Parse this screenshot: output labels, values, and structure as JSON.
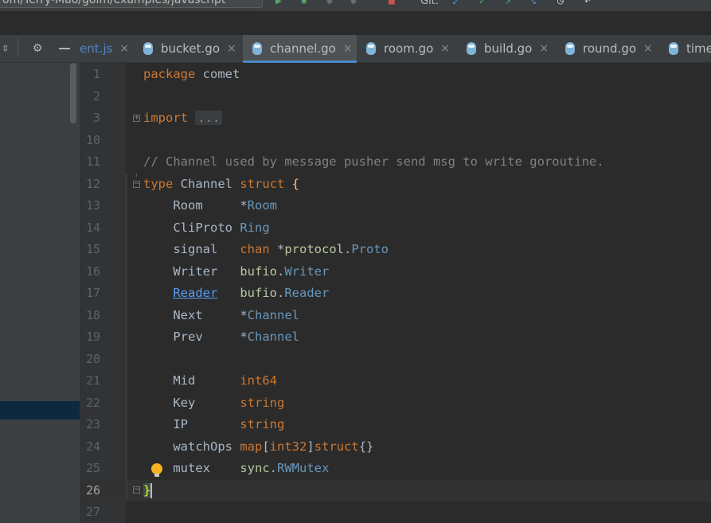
{
  "toolbar": {
    "path_text": "om/Terry-Mao/goim/examples/javascript",
    "git_label": "Git:"
  },
  "tabs": [
    {
      "label": "ent.js",
      "active": false
    },
    {
      "label": "bucket.go",
      "active": false
    },
    {
      "label": "channel.go",
      "active": true
    },
    {
      "label": "room.go",
      "active": false
    },
    {
      "label": "build.go",
      "active": false
    },
    {
      "label": "round.go",
      "active": false
    },
    {
      "label": "time",
      "active": false
    }
  ],
  "tab_close_glyph": "×",
  "editor": {
    "current_line": "26",
    "line_numbers": [
      "1",
      "2",
      "3",
      "10",
      "11",
      "12",
      "13",
      "14",
      "15",
      "16",
      "17",
      "18",
      "19",
      "20",
      "21",
      "22",
      "23",
      "24",
      "25",
      "26",
      "27"
    ],
    "code": {
      "l1_kw": "package",
      "l1_name": " comet",
      "l3_kw": "import",
      "l3_collapsed": "...",
      "l11_comment": "// Channel used by message pusher send msg to write goroutine.",
      "l12_kw": "type",
      "l12_name": " Channel ",
      "l12_kw2": "struct",
      "l12_brace": "{",
      "l13_field": "    Room     ",
      "l13_ptr": "*",
      "l13_type": "Room",
      "l14_field": "    CliProto ",
      "l14_type": "Ring",
      "l15_field": "    signal   ",
      "l15_kw": "chan",
      "l15_ptr": " *",
      "l15_pkg": "protocol",
      "l15_dot": ".",
      "l15_type": "Proto",
      "l16_field": "    Writer   ",
      "l16_pkg": "bufio",
      "l16_dot": ".",
      "l16_type": "Writer",
      "l17_indent": "    ",
      "l17_field": "Reader",
      "l17_pad": "   ",
      "l17_pkg": "bufio",
      "l17_dot": ".",
      "l17_type": "Reader",
      "l18_field": "    Next     ",
      "l18_ptr": "*",
      "l18_type": "Channel",
      "l19_field": "    Prev     ",
      "l19_ptr": "*",
      "l19_type": "Channel",
      "l21_field": "    Mid      ",
      "l21_type": "int64",
      "l22_field": "    Key      ",
      "l22_type": "string",
      "l23_field": "    IP       ",
      "l23_type": "string",
      "l24_field": "    watchOps ",
      "l24_kw": "map",
      "l24_b1": "[",
      "l24_kw2": "int32",
      "l24_b2": "]",
      "l24_kw3": "struct",
      "l24_br": "{}",
      "l25_field": "    mutex    ",
      "l25_pkg": "sync",
      "l25_dot": ".",
      "l25_type": "RWMutex",
      "l26_brace": "}"
    }
  },
  "colors": {
    "keyword": "#cc7832",
    "type": "#6897bb",
    "comment": "#808080",
    "brace": "#ffc66d",
    "accent": "#4a88c7"
  },
  "icons": [
    "filter-icon",
    "settings-gear-icon",
    "minimize-icon",
    "run-icon",
    "debug-icon",
    "git-update-icon",
    "git-commit-icon",
    "history-icon",
    "rollback-icon",
    "intention-bulb-icon",
    "fold-icon"
  ]
}
